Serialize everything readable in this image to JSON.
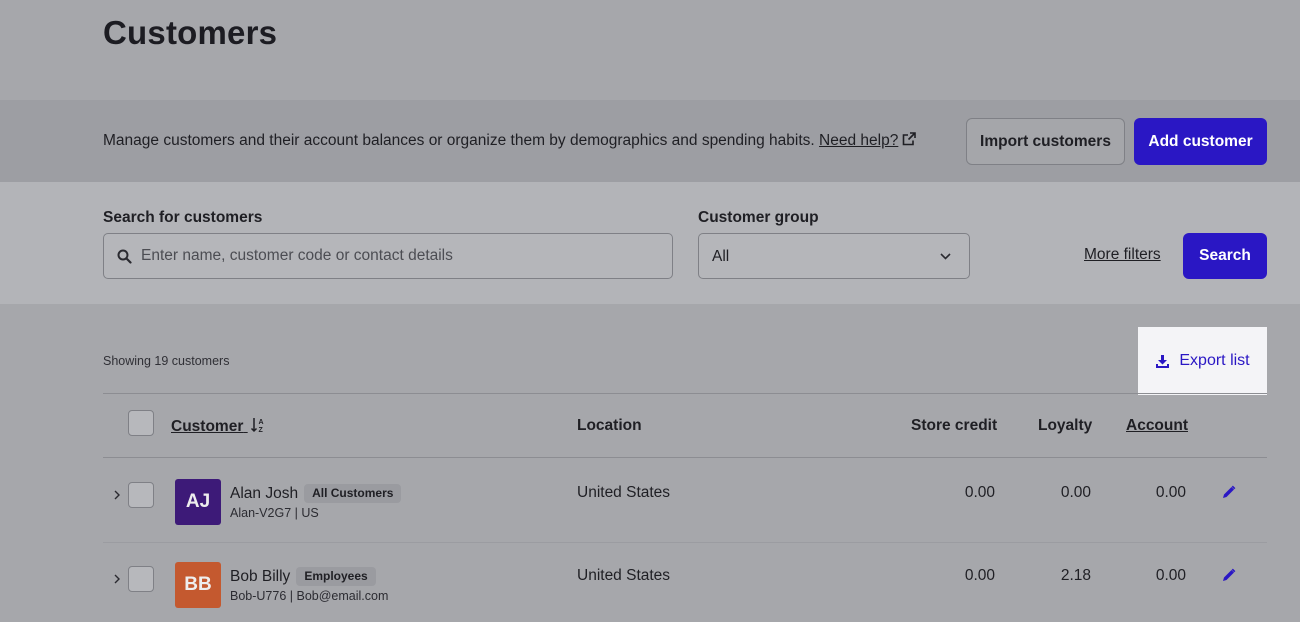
{
  "page": {
    "title": "Customers"
  },
  "banner": {
    "description": "Manage customers and their account balances or organize them by demographics and spending habits.",
    "help_link": "Need help?",
    "import_button": "Import customers",
    "add_button": "Add customer"
  },
  "filters": {
    "search_label": "Search for customers",
    "search_placeholder": "Enter name, customer code or contact details",
    "search_value": "",
    "group_label": "Customer group",
    "group_value": "All",
    "more_filters": "More filters",
    "search_button": "Search"
  },
  "list": {
    "showing": "Showing 19 customers",
    "export": "Export list",
    "columns": {
      "customer": "Customer",
      "location": "Location",
      "store_credit": "Store credit",
      "loyalty": "Loyalty",
      "account": "Account"
    },
    "rows": [
      {
        "initials": "AJ",
        "avatar_color": "#3d1a78",
        "name": "Alan Josh",
        "group": "All Customers",
        "sub": "Alan-V2G7 | US",
        "location": "United States",
        "store_credit": "0.00",
        "loyalty": "0.00",
        "account": "0.00"
      },
      {
        "initials": "BB",
        "avatar_color": "#c4592f",
        "name": "Bob Billy",
        "group": "Employees",
        "sub": "Bob-U776 | Bob@email.com",
        "location": "United States",
        "store_credit": "0.00",
        "loyalty": "2.18",
        "account": "0.00"
      }
    ]
  },
  "colors": {
    "accent": "#2a17c4",
    "page_bg": "#a6a7ab"
  }
}
